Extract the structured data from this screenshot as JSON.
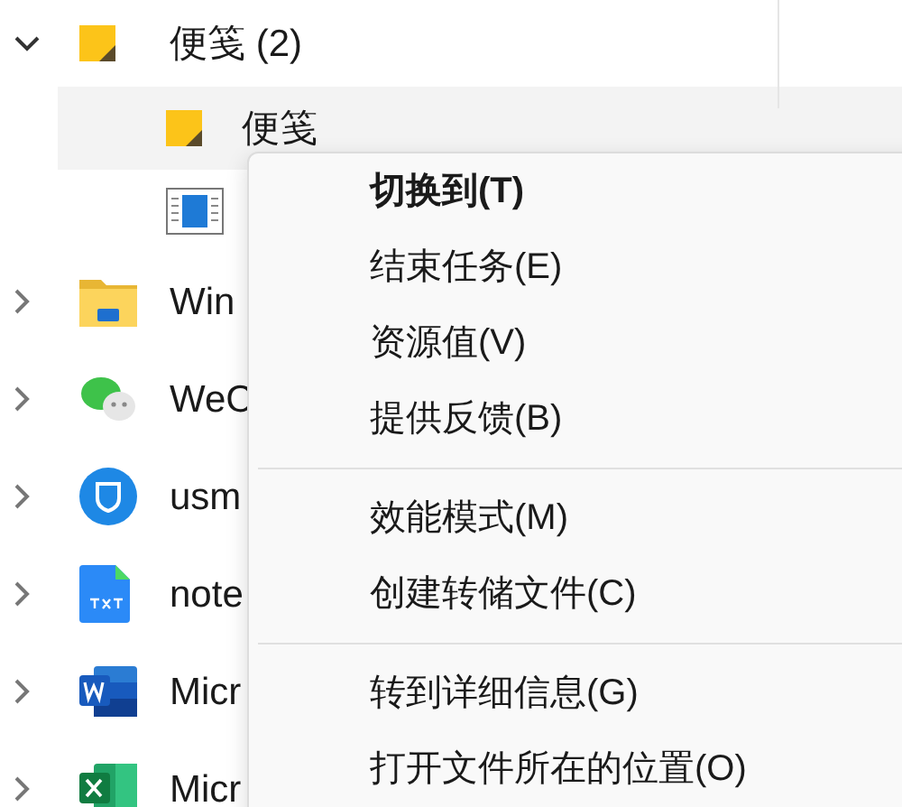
{
  "process_tree": [
    {
      "label": "便笺 (2)",
      "kind": "note",
      "expanded": true,
      "selected": false,
      "children": [
        {
          "label": "便笺",
          "kind": "note",
          "selected": true
        },
        {
          "kind": "window",
          "selected": false
        }
      ]
    },
    {
      "label": "Win",
      "kind": "folder",
      "expanded": false,
      "selected": false
    },
    {
      "label": "WeC",
      "kind": "chat",
      "expanded": false,
      "selected": false
    },
    {
      "label": "usm",
      "kind": "shield",
      "expanded": false,
      "selected": false
    },
    {
      "label": "note",
      "kind": "txt",
      "expanded": false,
      "selected": false
    },
    {
      "label": "Micr",
      "kind": "word",
      "expanded": false,
      "selected": false
    },
    {
      "label": "Micr",
      "kind": "excel",
      "expanded": false,
      "selected": false
    }
  ],
  "context_menu": {
    "groups": [
      [
        {
          "label": "切换到(T)",
          "default": true
        },
        {
          "label": "结束任务(E)",
          "default": false
        },
        {
          "label": "资源值(V)",
          "default": false
        },
        {
          "label": "提供反馈(B)",
          "default": false
        }
      ],
      [
        {
          "label": "效能模式(M)",
          "default": false
        },
        {
          "label": "创建转储文件(C)",
          "default": false
        }
      ],
      [
        {
          "label": "转到详细信息(G)",
          "default": false
        },
        {
          "label": "打开文件所在的位置(O)",
          "default": false
        }
      ]
    ]
  }
}
